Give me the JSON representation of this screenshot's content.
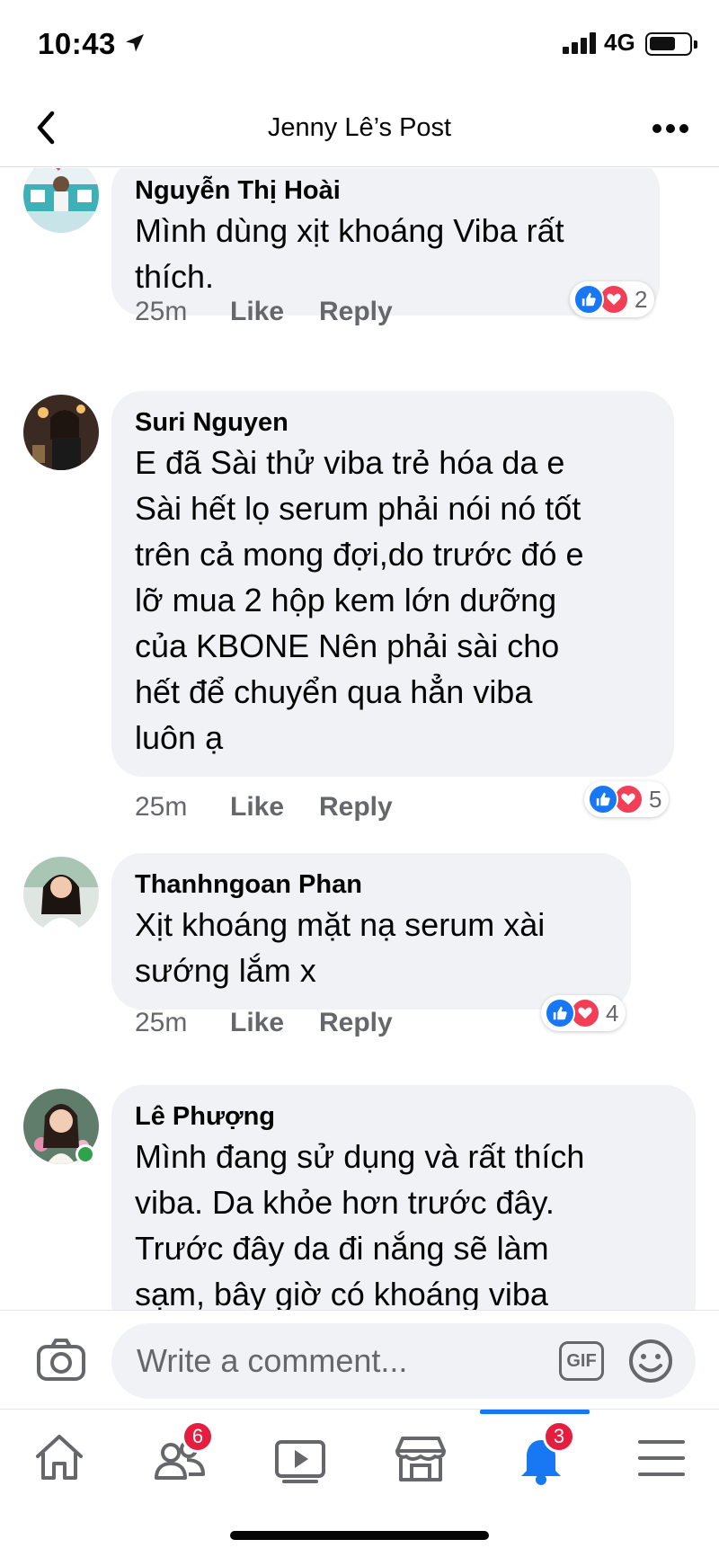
{
  "status_bar": {
    "time": "10:43",
    "network": "4G"
  },
  "header": {
    "title": "Jenny Lê’s Post"
  },
  "comments": [
    {
      "author": "Nguyễn Thị Hoài",
      "text": "Mình dùng xịt khoáng Viba rất\nthích.",
      "time": "25m",
      "like_label": "Like",
      "reply_label": "Reply",
      "reaction_count": "2"
    },
    {
      "author": "Suri Nguyen",
      "text": "E đã Sài thử viba trẻ hóa da e\nSài hết lọ serum phải nói nó tốt\ntrên cả mong đợi,do trước đó e\nlỡ mua 2 hộp kem  lớn dưỡng\ncủa KBONE Nên phải sài cho\nhết để chuyển qua hẳn viba\nluôn ạ",
      "time": "25m",
      "like_label": "Like",
      "reply_label": "Reply",
      "reaction_count": "5"
    },
    {
      "author": "Thanhngoan Phan",
      "text": "Xịt khoáng mặt nạ serum xài\nsướng lắm x",
      "time": "25m",
      "like_label": "Like",
      "reply_label": "Reply",
      "reaction_count": "4"
    },
    {
      "author": "Lê Phượng",
      "text": "Mình đang sử dụng và rất thích\nviba. Da khỏe hơn trước đây.\nTrước đây da đi nắng sẽ làm\nsạm, bây giờ có khoáng viba",
      "online": true
    }
  ],
  "composer": {
    "placeholder": "Write a comment...",
    "gif_label": "GIF"
  },
  "tabbar": {
    "friends_badge": "6",
    "notifications_badge": "3"
  },
  "colors": {
    "accent": "#1877f2",
    "badge": "#e41e3f",
    "bubble": "#f0f2f5",
    "love": "#f33e58",
    "online": "#31a24c"
  },
  "icons": [
    "location-arrow-icon",
    "signal-icon",
    "battery-icon",
    "back-icon",
    "more-icon",
    "like-reaction-icon",
    "love-reaction-icon",
    "camera-icon",
    "gif-icon",
    "emoji-icon",
    "home-icon",
    "friends-icon",
    "watch-icon",
    "marketplace-icon",
    "notifications-icon",
    "menu-icon"
  ]
}
